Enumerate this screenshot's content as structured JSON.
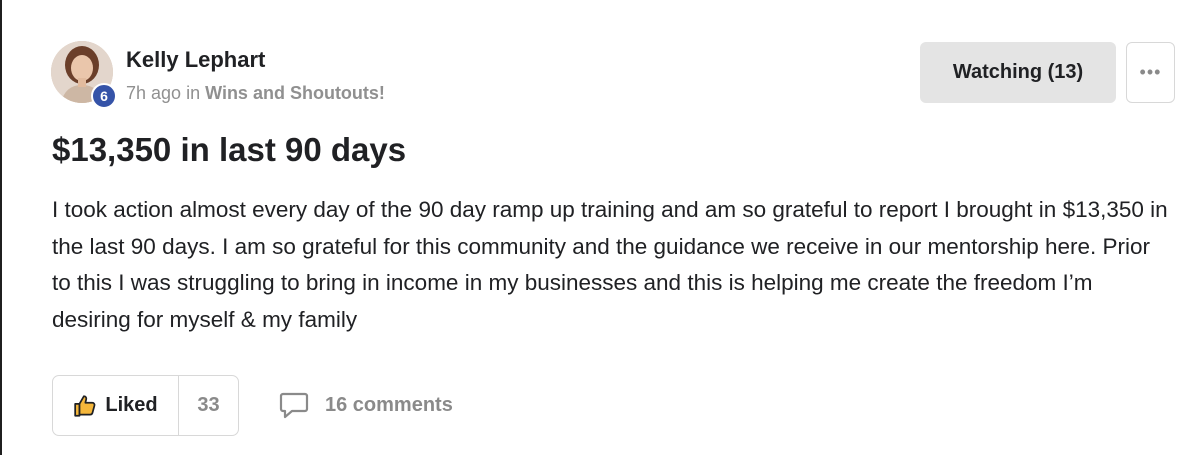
{
  "post": {
    "author": {
      "name": "Kelly Lephart",
      "level": "6",
      "avatar_icon": "user-avatar-photo"
    },
    "meta": {
      "time_ago": "7h ago",
      "in_text": "in",
      "category": "Wins and Shoutouts!"
    },
    "actions": {
      "watching_label": "Watching (13)",
      "more_label": "•••"
    },
    "title": "$13,350 in last 90 days",
    "body": "I took action almost every day of the 90 day ramp up training and am so grateful to report I brought in $13,350 in the last 90 days. I am so grateful for this community and the guidance we receive in our mentorship here. Prior to this I was struggling to bring in income in my businesses and this is helping me create the freedom I’m desiring for myself & my family",
    "footer": {
      "like_label": "Liked",
      "like_icon": "thumbs-up-icon",
      "like_count": "33",
      "comments_label": "16 comments",
      "comments_icon": "comment-bubble-icon"
    }
  },
  "colors": {
    "level_badge": "#3553a8",
    "watch_button_bg": "#e4e4e4",
    "muted_text": "#8a8a8a"
  }
}
